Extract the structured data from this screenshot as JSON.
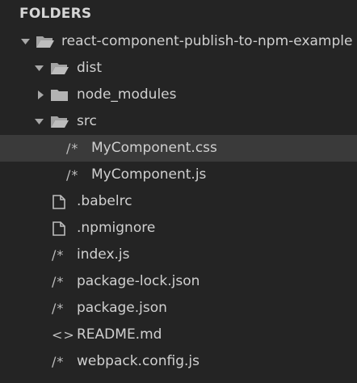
{
  "sidebar": {
    "header": "FOLDERS",
    "items": [
      {
        "label": "react-component-publish-to-npm-example",
        "icon": "folder-open-icon",
        "glyph": ""
      },
      {
        "label": "dist",
        "icon": "folder-open-icon",
        "glyph": ""
      },
      {
        "label": "node_modules",
        "icon": "folder-icon",
        "glyph": ""
      },
      {
        "label": "src",
        "icon": "folder-open-icon",
        "glyph": ""
      },
      {
        "label": "MyComponent.css",
        "icon": "comment-syntax-icon",
        "glyph": "/*"
      },
      {
        "label": "MyComponent.js",
        "icon": "comment-syntax-icon",
        "glyph": "/*"
      },
      {
        "label": ".babelrc",
        "icon": "file-icon",
        "glyph": ""
      },
      {
        "label": ".npmignore",
        "icon": "file-icon",
        "glyph": ""
      },
      {
        "label": "index.js",
        "icon": "comment-syntax-icon",
        "glyph": "/*"
      },
      {
        "label": "package-lock.json",
        "icon": "comment-syntax-icon",
        "glyph": "/*"
      },
      {
        "label": "package.json",
        "icon": "comment-syntax-icon",
        "glyph": "/*"
      },
      {
        "label": "README.md",
        "icon": "markup-syntax-icon",
        "glyph": "<>"
      },
      {
        "label": "webpack.config.js",
        "icon": "comment-syntax-icon",
        "glyph": "/*"
      }
    ],
    "selected_item": "MyComponent.css"
  },
  "colors": {
    "background": "#242424",
    "selected_row": "#3a3a3a",
    "text": "#d0d0d0",
    "icon": "#bfbfbf"
  }
}
